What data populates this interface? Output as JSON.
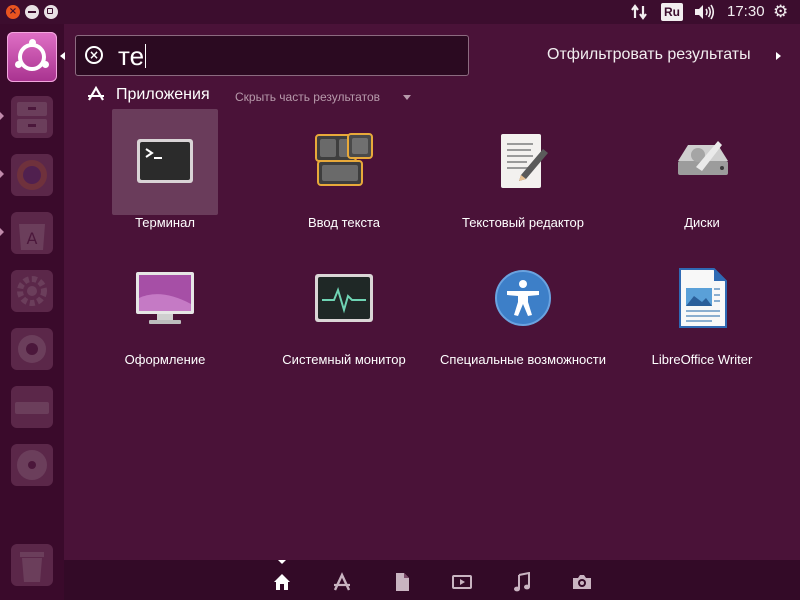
{
  "window_controls": {
    "close_icon": "close-icon",
    "minimize_icon": "minimize-icon",
    "maximize_icon": "maximize-icon"
  },
  "top_panel": {
    "network_icon": "network-updown-icon",
    "keyboard_layout": "Ru",
    "volume_icon": "speaker-icon",
    "time": "17:30",
    "session_icon": "gear-icon"
  },
  "launcher": {
    "items": [
      {
        "name": "dash-home",
        "icon": "ubuntu-logo-icon",
        "active": true
      },
      {
        "name": "files",
        "icon": "file-cabinet-icon",
        "active": false
      },
      {
        "name": "firefox",
        "icon": "firefox-icon",
        "active": false
      },
      {
        "name": "software-center",
        "icon": "software-center-icon",
        "active": false
      },
      {
        "name": "settings",
        "icon": "wrench-gear-icon",
        "active": false
      },
      {
        "name": "shotwell",
        "icon": "aperture-icon",
        "active": false
      },
      {
        "name": "drive",
        "icon": "drive-icon",
        "active": false
      },
      {
        "name": "disc",
        "icon": "disc-icon",
        "active": false
      },
      {
        "name": "trash",
        "icon": "trash-icon",
        "active": false
      }
    ]
  },
  "search": {
    "value": "те",
    "clear_icon": "clear-icon"
  },
  "filter": {
    "label": "Отфильтровать результаты"
  },
  "category": {
    "icon": "applications-icon",
    "title": "Приложения",
    "toggle_label": "Скрыть часть результатов"
  },
  "apps": [
    {
      "label": "Терминал",
      "icon": "terminal-icon",
      "selected": true
    },
    {
      "label": "Ввод текста",
      "icon": "text-entry-icon",
      "selected": false
    },
    {
      "label": "Текстовый редактор",
      "icon": "text-editor-icon",
      "selected": false
    },
    {
      "label": "Диски",
      "icon": "disks-icon",
      "selected": false
    },
    {
      "label": "Оформление",
      "icon": "appearance-icon",
      "selected": false
    },
    {
      "label": "Системный монитор",
      "icon": "system-monitor-icon",
      "selected": false
    },
    {
      "label": "Специальные возможности",
      "icon": "accessibility-icon",
      "selected": false
    },
    {
      "label": "LibreOffice Writer",
      "icon": "libreoffice-writer-icon",
      "selected": false
    }
  ],
  "lenses": [
    {
      "name": "home",
      "icon": "home-icon",
      "active": true
    },
    {
      "name": "applications",
      "icon": "applications-icon",
      "active": false
    },
    {
      "name": "files",
      "icon": "file-icon",
      "active": false
    },
    {
      "name": "video",
      "icon": "video-icon",
      "active": false
    },
    {
      "name": "music",
      "icon": "music-icon",
      "active": false
    },
    {
      "name": "photos",
      "icon": "camera-icon",
      "active": false
    }
  ],
  "colors": {
    "background": "#4a1238",
    "panel": "#3c0d2e",
    "accent": "#e95420",
    "home_button": "#c24aa6"
  }
}
